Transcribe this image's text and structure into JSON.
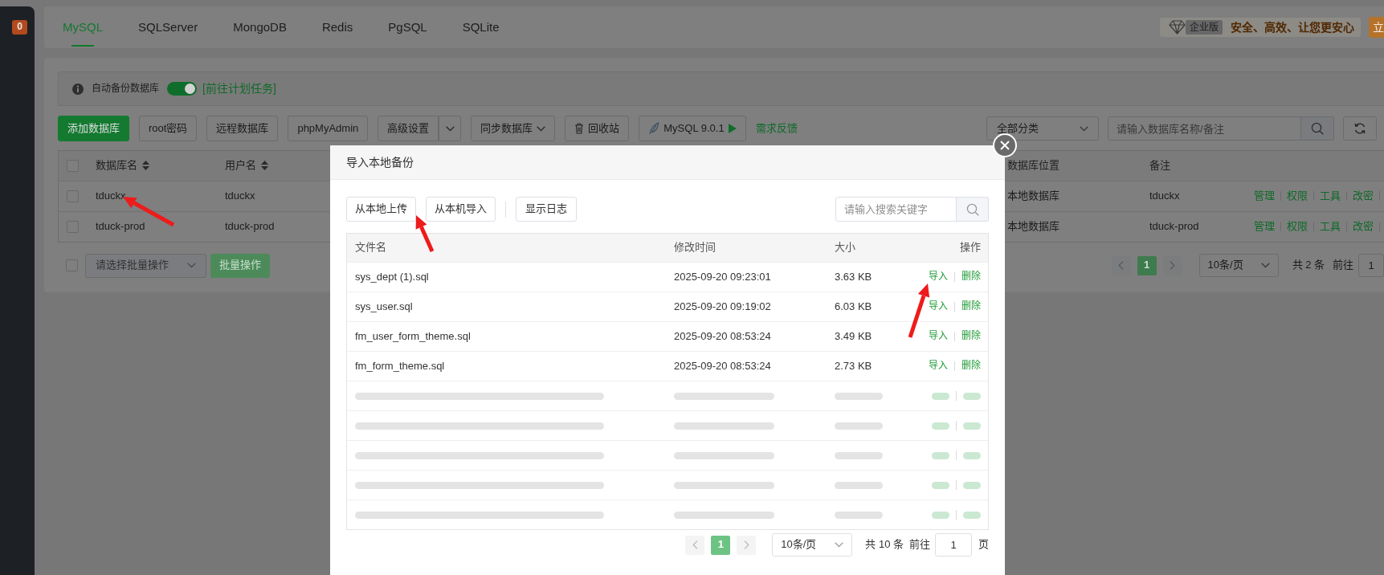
{
  "sidebar": {
    "badge": "0"
  },
  "db_tabs": [
    {
      "label": "MySQL",
      "selected": true
    },
    {
      "label": "SQLServer",
      "selected": false
    },
    {
      "label": "MongoDB",
      "selected": false
    },
    {
      "label": "Redis",
      "selected": false
    },
    {
      "label": "PgSQL",
      "selected": false
    },
    {
      "label": "SQLite",
      "selected": false
    }
  ],
  "promo": {
    "edition_tag": "企业版",
    "slogan": "安全、高效、让您更安心",
    "button": "立"
  },
  "auto_backup": {
    "label": "自动备份数据库",
    "on": true,
    "link": "[前往计划任务]"
  },
  "toolbar": {
    "buttons": [
      {
        "label": "添加数据库",
        "kind": "primary"
      },
      {
        "label": "root密码",
        "kind": "plain"
      },
      {
        "label": "远程数据库",
        "kind": "plain"
      },
      {
        "label": "phpMyAdmin",
        "kind": "plain"
      },
      {
        "label": "高级设置",
        "kind": "split"
      },
      {
        "label": "同步数据库",
        "kind": "dropdown"
      },
      {
        "label": "回收站",
        "kind": "trash"
      },
      {
        "label": "MySQL 9.0.1",
        "kind": "version"
      }
    ],
    "feedback_link": "需求反馈",
    "category": "全部分类",
    "search": {
      "placeholder": "请输入数据库名称/备注"
    }
  },
  "db_table": {
    "select_all_checked": false,
    "columns": [
      {
        "label": "数据库名",
        "sortable": true
      },
      {
        "label": "用户名",
        "sortable": true
      },
      {
        "label": "数据库位置",
        "sortable": false
      },
      {
        "label": "备注",
        "sortable": false
      }
    ],
    "rows": [
      {
        "checked": false,
        "name": "tduckx",
        "user": "tduckx",
        "location": "本地数据库",
        "note": "tduckx",
        "actions": [
          "管理",
          "权限",
          "工具",
          "改密"
        ]
      },
      {
        "checked": false,
        "name": "tduck-prod",
        "user": "tduck-prod",
        "location": "本地数据库",
        "note": "tduck-prod",
        "actions": [
          "管理",
          "权限",
          "工具",
          "改密"
        ]
      }
    ]
  },
  "batch": {
    "checked": false,
    "placeholder": "请选择批量操作",
    "button": "批量操作",
    "button_disabled": true
  },
  "db_pagination": {
    "pages": [
      {
        "label": "1",
        "selected": true
      }
    ],
    "page_size": "10条/页",
    "total": "共 2 条",
    "goto_label": "前往",
    "goto_value": "1"
  },
  "modal": {
    "title": "导入本地备份",
    "buttons": [
      "从本地上传",
      "从本机导入"
    ],
    "log_button": "显示日志",
    "search": {
      "placeholder": "请输入搜索关键字"
    },
    "table": {
      "columns": [
        "文件名",
        "修改时间",
        "大小",
        "操作"
      ],
      "rows": [
        {
          "blurred": false,
          "file": "sys_dept (1).sql",
          "modified": "2025-09-20 09:23:01",
          "size": "3.63 KB",
          "actions": [
            "导入",
            "删除"
          ]
        },
        {
          "blurred": false,
          "file": "sys_user.sql",
          "modified": "2025-09-20 09:19:02",
          "size": "6.03 KB",
          "actions": [
            "导入",
            "删除"
          ]
        },
        {
          "blurred": false,
          "file": "fm_user_form_theme.sql",
          "modified": "2025-09-20 08:53:24",
          "size": "3.49 KB",
          "actions": [
            "导入",
            "删除"
          ]
        },
        {
          "blurred": false,
          "file": "fm_form_theme.sql",
          "modified": "2025-09-20 08:53:24",
          "size": "2.73 KB",
          "actions": [
            "导入",
            "删除"
          ]
        },
        {
          "blurred": true
        },
        {
          "blurred": true
        },
        {
          "blurred": true
        },
        {
          "blurred": true
        },
        {
          "blurred": true
        }
      ]
    },
    "pagination": {
      "pages": [
        {
          "label": "1",
          "selected": true
        }
      ],
      "page_size": "10条/页",
      "total": "共 10 条",
      "goto_label": "前往",
      "goto_value": "1",
      "goto_suffix": "页"
    }
  }
}
